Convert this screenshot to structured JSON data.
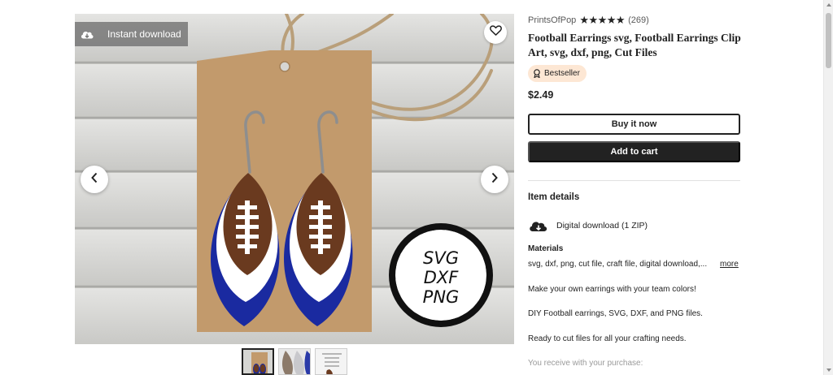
{
  "listing_image": {
    "instant_badge": "Instant download",
    "icons": {
      "instant": "cloud-download-icon",
      "favorite": "heart-icon",
      "prev": "chevron-left-icon",
      "next": "chevron-right-icon"
    },
    "stamp_lines": [
      "SVG",
      "DXF",
      "PNG"
    ],
    "colors": {
      "leather": "#6a3a1f",
      "blue": "#1a2aa0",
      "kraft": "#c29a6c"
    }
  },
  "thumbnails": [
    {
      "label": ""
    },
    {
      "label": ""
    },
    {
      "label": ""
    }
  ],
  "shop": {
    "name": "PrintsOfPop",
    "stars": "★★★★★",
    "review_count": "(269)"
  },
  "product": {
    "title": "Football Earrings svg, Football Earrings Clip Art, svg, dxf, png, Cut Files",
    "badge": "Bestseller",
    "price": "$2.49"
  },
  "actions": {
    "buy_now": "Buy it now",
    "add_to_cart": "Add to cart"
  },
  "details": {
    "heading": "Item details",
    "download": "Digital download (1 ZIP)",
    "materials_heading": "Materials",
    "materials": "svg, dxf, png, cut file, craft file, digital download,...",
    "more": "more",
    "description": [
      "Make your own earrings with your team colors!",
      "DIY Football earrings, SVG, DXF, and PNG files.",
      "Ready to cut files for all your crafting needs.",
      "You receive with your purchase:"
    ]
  }
}
